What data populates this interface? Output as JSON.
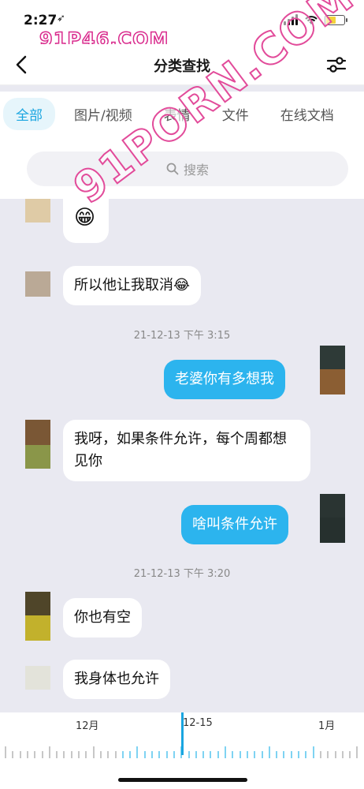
{
  "status": {
    "time": "2:27",
    "location_glyph": "➶"
  },
  "watermark": {
    "small": "91P46.COM",
    "big": "91PORN.COM"
  },
  "nav": {
    "title": "分类查找",
    "back_icon": "chevron-left-icon",
    "filter_icon": "sliders-icon"
  },
  "tabs": [
    {
      "label": "全部",
      "active": true
    },
    {
      "label": "图片/视频",
      "active": false
    },
    {
      "label": "表情",
      "active": false
    },
    {
      "label": "文件",
      "active": false
    },
    {
      "label": "在线文档",
      "active": false
    }
  ],
  "search": {
    "placeholder": "搜索"
  },
  "messages": {
    "m1": {
      "emoji": "😁",
      "sender": "other"
    },
    "m2": {
      "text": "所以他让我取消😂",
      "sender": "other"
    },
    "ts1": "21-12-13 下午 3:15",
    "m3": {
      "text": "老婆你有多想我",
      "sender": "me"
    },
    "m4": {
      "text": "我呀，如果条件允许，每个周都想见你",
      "sender": "other"
    },
    "m5": {
      "text": "啥叫条件允许",
      "sender": "me"
    },
    "ts2": "21-12-13 下午 3:20",
    "m6": {
      "text": "你也有空",
      "sender": "other"
    },
    "m7": {
      "text": "我身体也允许",
      "sender": "other"
    }
  },
  "timeline": {
    "left": "12月",
    "center": "12-15",
    "right": "1月"
  },
  "colors": {
    "accent": "#19a5e0",
    "me_bubble": "#2cb4ee",
    "chat_bg": "#e9e9f1"
  }
}
